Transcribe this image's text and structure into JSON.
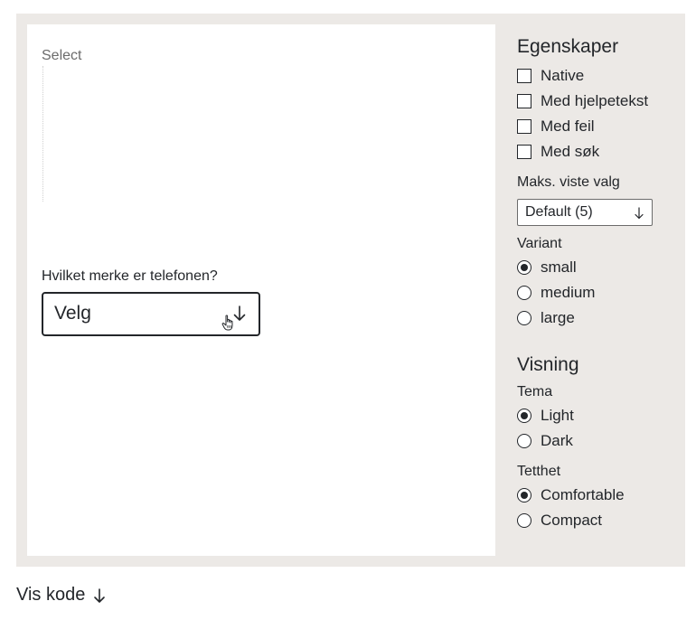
{
  "preview": {
    "component_label": "Select",
    "field_label": "Hvilket merke er telefonen?",
    "select_value": "Velg",
    "icons": {
      "arrow": "arrow-down-icon",
      "cursor": "hand-pointer-cursor-icon"
    }
  },
  "panel": {
    "properties_heading": "Egenskaper",
    "checkboxes": [
      {
        "label": "Native",
        "checked": false
      },
      {
        "label": "Med hjelpetekst",
        "checked": false
      },
      {
        "label": "Med feil",
        "checked": false
      },
      {
        "label": "Med søk",
        "checked": false
      }
    ],
    "max_options_label": "Maks. viste valg",
    "max_options_value": "Default (5)",
    "variant_label": "Variant",
    "variant_options": [
      {
        "label": "small",
        "checked": true
      },
      {
        "label": "medium",
        "checked": false
      },
      {
        "label": "large",
        "checked": false
      }
    ],
    "display_heading": "Visning",
    "theme_label": "Tema",
    "theme_options": [
      {
        "label": "Light",
        "checked": true
      },
      {
        "label": "Dark",
        "checked": false
      }
    ],
    "density_label": "Tetthet",
    "density_options": [
      {
        "label": "Comfortable",
        "checked": true
      },
      {
        "label": "Compact",
        "checked": false
      }
    ]
  },
  "footer": {
    "show_code_label": "Vis kode"
  },
  "colors": {
    "frame_bg": "#ece9e6",
    "text": "#23262a",
    "muted": "#6b6b6b"
  }
}
